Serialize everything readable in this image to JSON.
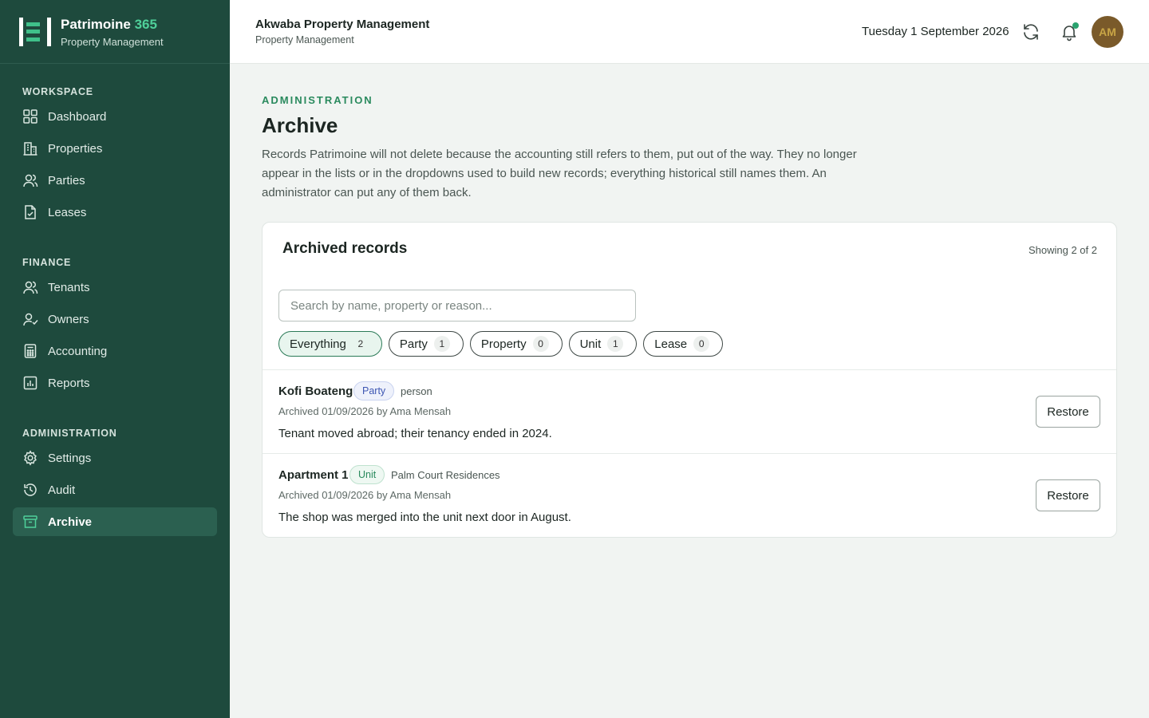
{
  "brand": {
    "name": "Patrimoine",
    "name_accent": "365",
    "subtitle": "Property Management"
  },
  "sidebar": {
    "sections": [
      {
        "label": "WORKSPACE",
        "items": [
          {
            "label": "Dashboard",
            "icon": "grid-icon"
          },
          {
            "label": "Properties",
            "icon": "building-icon"
          },
          {
            "label": "Parties",
            "icon": "people-icon"
          },
          {
            "label": "Leases",
            "icon": "document-icon"
          }
        ]
      },
      {
        "label": "FINANCE",
        "items": [
          {
            "label": "Tenants",
            "icon": "users-icon"
          },
          {
            "label": "Owners",
            "icon": "user-check-icon"
          },
          {
            "label": "Accounting",
            "icon": "calculator-icon"
          },
          {
            "label": "Reports",
            "icon": "bar-chart-icon"
          }
        ]
      },
      {
        "label": "ADMINISTRATION",
        "items": [
          {
            "label": "Settings",
            "icon": "gear-icon"
          },
          {
            "label": "Audit",
            "icon": "history-icon"
          },
          {
            "label": "Archive",
            "icon": "archive-icon",
            "active": true
          }
        ]
      }
    ]
  },
  "header": {
    "org_name": "Akwaba Property Management",
    "org_subtitle": "Property Management",
    "date": "Tuesday 1 September 2026",
    "avatar_initials": "AM",
    "accent_color": "#2aa36f"
  },
  "page": {
    "eyebrow": "ADMINISTRATION",
    "title": "Archive",
    "description": "Records Patrimoine will not delete because the accounting still refers to them, put out of the way. They no longer appear in the lists or in the dropdowns used to build new records; everything historical still names them. An administrator can put any of them back."
  },
  "card": {
    "title": "Archived records",
    "count_text": "Showing 2 of 2",
    "search_placeholder": "Search by name, property or reason...",
    "search_value": "",
    "filters": [
      {
        "label": "Everything",
        "count": "2",
        "active": true
      },
      {
        "label": "Party",
        "count": "1"
      },
      {
        "label": "Property",
        "count": "0"
      },
      {
        "label": "Unit",
        "count": "1"
      },
      {
        "label": "Lease",
        "count": "0"
      }
    ],
    "records": [
      {
        "name": "Kofi Boateng",
        "type": "Party",
        "kind": "person",
        "meta": "Archived 01/09/2026 by Ama Mensah",
        "reason": "Tenant moved abroad; their tenancy ended in 2024.",
        "action": "Restore"
      },
      {
        "name": "Apartment 1",
        "type": "Unit",
        "kind": "Palm Court Residences",
        "meta": "Archived 01/09/2026 by Ama Mensah",
        "reason": "The shop was merged into the unit next door in August.",
        "action": "Restore"
      }
    ]
  }
}
